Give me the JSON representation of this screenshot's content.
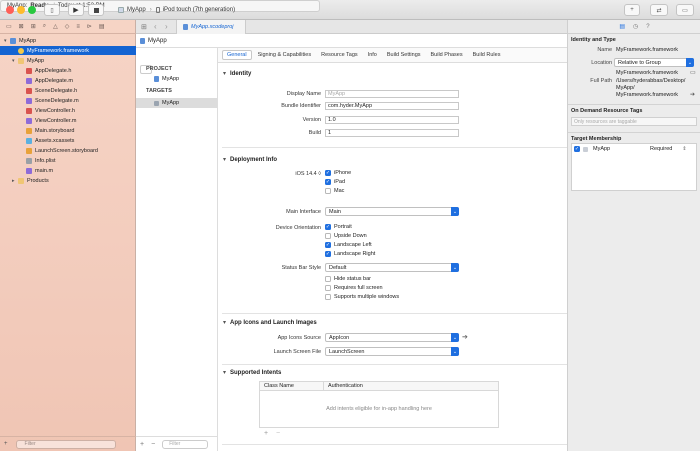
{
  "toolbar": {
    "scheme_target": "MyApp",
    "scheme_device": "iPod touch (7th generation)",
    "status_app": "MyApp:",
    "status_state": "Ready",
    "status_time": "Today at 1:52 PM"
  },
  "navigator": {
    "rows": [
      {
        "label": "MyApp",
        "level": 0,
        "type": "project",
        "disclosure": "▾"
      },
      {
        "label": "MyFramework.framework",
        "level": 1,
        "type": "framework",
        "selected": true
      },
      {
        "label": "MyApp",
        "level": 1,
        "type": "folder",
        "disclosure": "▾"
      },
      {
        "label": "AppDelegate.h",
        "level": 2,
        "type": "h"
      },
      {
        "label": "AppDelegate.m",
        "level": 2,
        "type": "m"
      },
      {
        "label": "SceneDelegate.h",
        "level": 2,
        "type": "h"
      },
      {
        "label": "SceneDelegate.m",
        "level": 2,
        "type": "m"
      },
      {
        "label": "ViewController.h",
        "level": 2,
        "type": "h"
      },
      {
        "label": "ViewController.m",
        "level": 2,
        "type": "m"
      },
      {
        "label": "Main.storyboard",
        "level": 2,
        "type": "storyboard"
      },
      {
        "label": "Assets.xcassets",
        "level": 2,
        "type": "assets"
      },
      {
        "label": "LaunchScreen.storyboard",
        "level": 2,
        "type": "storyboard"
      },
      {
        "label": "Info.plist",
        "level": 2,
        "type": "plist"
      },
      {
        "label": "main.m",
        "level": 2,
        "type": "m"
      },
      {
        "label": "Products",
        "level": 1,
        "type": "folder",
        "disclosure": "▸"
      }
    ],
    "filter_placeholder": "Filter"
  },
  "editor": {
    "tab_label": "MyApp.xcodeproj",
    "jump_project": "MyApp",
    "project_header": "PROJECT",
    "project_item": "MyApp",
    "targets_header": "TARGETS",
    "target_item": "MyApp",
    "target_filter_placeholder": "Filter",
    "tabs": [
      "General",
      "Signing & Capabilities",
      "Resource Tags",
      "Info",
      "Build Settings",
      "Build Phases",
      "Build Rules"
    ],
    "identity": {
      "title": "Identity",
      "display_name_label": "Display Name",
      "display_name_placeholder": "MyApp",
      "bundle_id_label": "Bundle Identifier",
      "bundle_id": "com.hyder.MyApp",
      "version_label": "Version",
      "version": "1.0",
      "build_label": "Build",
      "build": "1"
    },
    "deployment": {
      "title": "Deployment Info",
      "ios_label": "iOS 14.4 ◊",
      "devices": [
        {
          "label": "iPhone",
          "checked": true
        },
        {
          "label": "iPad",
          "checked": true
        },
        {
          "label": "Mac",
          "checked": false
        }
      ],
      "main_interface_label": "Main Interface",
      "main_interface": "Main",
      "orientation_label": "Device Orientation",
      "orientations": [
        {
          "label": "Portrait",
          "checked": true
        },
        {
          "label": "Upside Down",
          "checked": false
        },
        {
          "label": "Landscape Left",
          "checked": true
        },
        {
          "label": "Landscape Right",
          "checked": true
        }
      ],
      "status_bar_label": "Status Bar Style",
      "status_bar": "Default",
      "status_opts": [
        {
          "label": "Hide status bar",
          "checked": false
        },
        {
          "label": "Requires full screen",
          "checked": false
        },
        {
          "label": "Supports multiple windows",
          "checked": false
        }
      ]
    },
    "icons": {
      "title": "App Icons and Launch Images",
      "app_icons_label": "App Icons Source",
      "app_icons": "AppIcon",
      "launch_label": "Launch Screen File",
      "launch": "LaunchScreen"
    },
    "intents": {
      "title": "Supported Intents",
      "col_class": "Class Name",
      "col_auth": "Authentication",
      "empty": "Add intents eligible for in-app handling here"
    }
  },
  "inspector": {
    "identity_title": "Identity and Type",
    "name_label": "Name",
    "name": "MyFramework.framework",
    "location_label": "Location",
    "location": "Relative to Group",
    "location_file": "MyFramework.framework",
    "full_path_label": "Full Path",
    "full_path_1": "/Users/hyderabbas/Desktop/",
    "full_path_2": "MyApp/",
    "full_path_3": "MyFramework.framework",
    "odr_title": "On Demand Resource Tags",
    "odr_placeholder": "Only resources are taggable",
    "membership_title": "Target Membership",
    "membership_target": "MyApp",
    "membership_role": "Required"
  },
  "colors": {
    "selection": "#1464d2",
    "accent": "#1f6fe0",
    "navigator_bg": "#f3cdbe"
  }
}
